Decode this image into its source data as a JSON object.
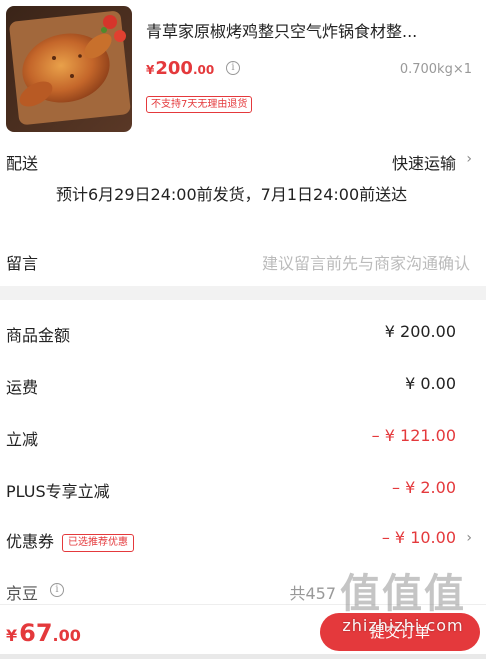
{
  "product": {
    "image_icon": "roast-chicken-photo",
    "title": "青草家原椒烤鸡整只空气炸锅食材整...",
    "price_currency": "¥",
    "price_int": "200",
    "price_dec": ".00",
    "info_icon": "i",
    "spec": "0.700kg×1",
    "tag": "不支持7天无理由退货"
  },
  "delivery": {
    "label": "配送",
    "method": "快速运输",
    "chevron": "›",
    "date_text": "预计6月29日24:00前发货，7月1日24:00前送达"
  },
  "memo": {
    "label": "留言",
    "placeholder": "建议留言前先与商家沟通确认"
  },
  "summary": {
    "goods_label": "商品金额",
    "goods_value": "¥ 200.00",
    "shipping_label": "运费",
    "shipping_value": "¥ 0.00",
    "discount_label": "立减",
    "discount_value": "– ¥ 121.00",
    "plus_label": "PLUS专享立减",
    "plus_value": "– ¥ 2.00",
    "coupon_label": "优惠券",
    "coupon_tag": "已选推荐优惠",
    "coupon_value": "– ¥ 10.00",
    "coupon_chevron": "›",
    "jingdou_label": "京豆",
    "jingdou_info": "i",
    "jingdou_value": "共457"
  },
  "bottom": {
    "total_currency": "¥",
    "total_int": "67",
    "total_dec": ".00",
    "submit_label": "提交订单"
  },
  "watermark": {
    "logo": "值值值",
    "text": "zhizhizhi.com"
  },
  "colors": {
    "accent": "#e4393c",
    "muted": "#999999",
    "divider": "#f2f2f2"
  }
}
